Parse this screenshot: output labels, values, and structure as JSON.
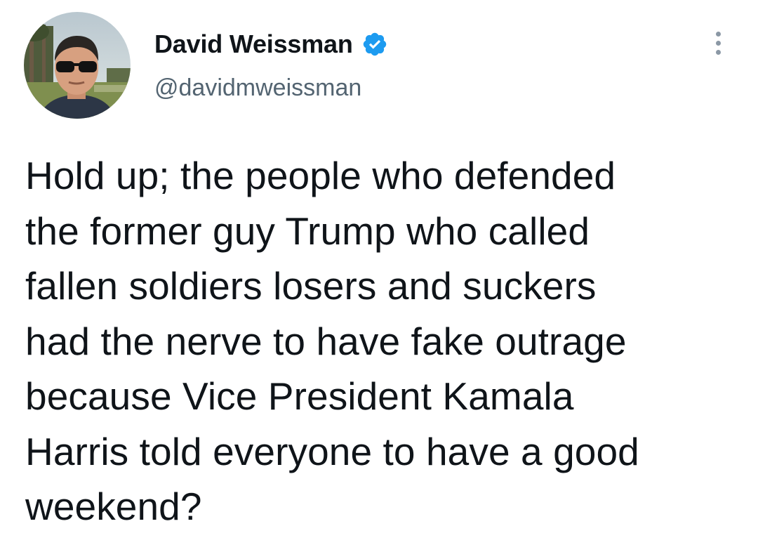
{
  "tweet": {
    "author": {
      "display_name": "David Weissman",
      "handle": "@davidmweissman",
      "verified": true,
      "avatar_icon": "profile-photo"
    },
    "text": "Hold up; the people who defended\nthe former guy Trump who called\nfallen soldiers losers and suckers\nhad the nerve to have fake outrage\nbecause Vice President Kamala\nHarris told everyone to have a good\nweekend?",
    "menu_icon": "more-vertical-icon"
  },
  "colors": {
    "verified_badge": "#1d9bf0",
    "handle_text": "#536471",
    "body_text": "#0f1419"
  }
}
